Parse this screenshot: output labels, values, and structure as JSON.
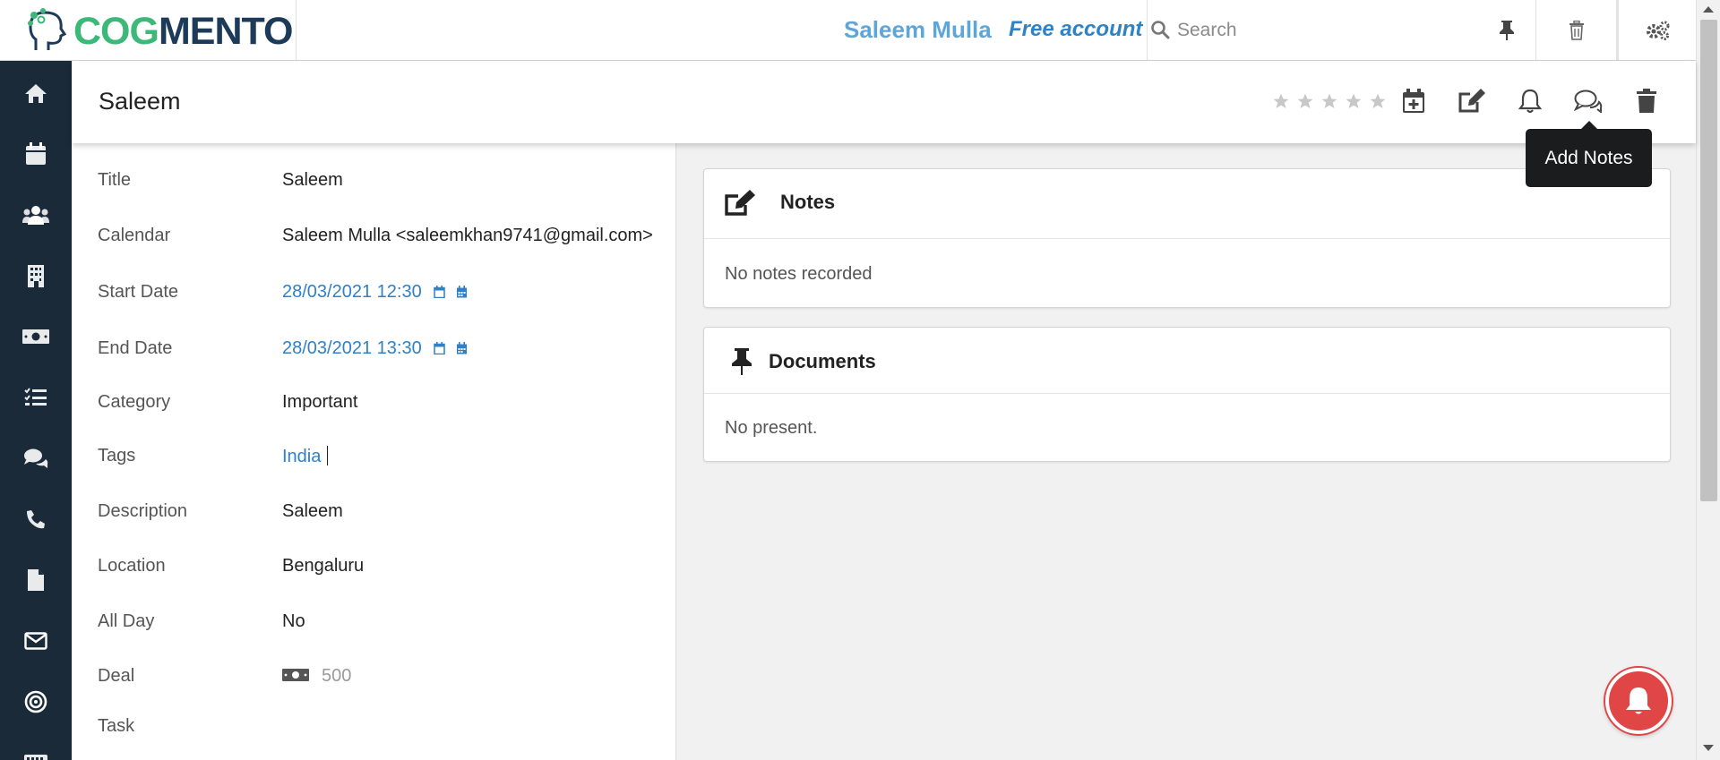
{
  "header": {
    "logo_prefix": "COG",
    "logo_suffix": "MENTO",
    "user_name": "Saleem Mulla",
    "account_type": "Free account",
    "search_placeholder": "Search",
    "icons": [
      "search-icon",
      "pin-icon",
      "trash-icon",
      "settings-icon"
    ]
  },
  "sidebar": {
    "items": [
      {
        "name": "home",
        "icon": "home-icon"
      },
      {
        "name": "calendar",
        "icon": "calendar-icon"
      },
      {
        "name": "contacts",
        "icon": "users-icon"
      },
      {
        "name": "companies",
        "icon": "building-icon"
      },
      {
        "name": "deals",
        "icon": "money-icon"
      },
      {
        "name": "tasks",
        "icon": "tasks-icon"
      },
      {
        "name": "cases",
        "icon": "comments-icon"
      },
      {
        "name": "calls",
        "icon": "phone-icon"
      },
      {
        "name": "documents",
        "icon": "file-icon"
      },
      {
        "name": "email",
        "icon": "mail-icon"
      },
      {
        "name": "campaigns",
        "icon": "target-icon"
      },
      {
        "name": "forms",
        "icon": "keyboard-icon"
      }
    ]
  },
  "record": {
    "title": "Saleem",
    "rating": 0,
    "rating_max": 5,
    "actions": [
      "add-to-calendar",
      "edit",
      "reminder",
      "add-notes",
      "delete"
    ],
    "tooltip": "Add Notes"
  },
  "details": {
    "fields": [
      {
        "label": "Title",
        "value": "Saleem"
      },
      {
        "label": "Calendar",
        "value": "Saleem Mulla <saleemkhan9741@gmail.com>"
      },
      {
        "label": "Start Date",
        "value": "28/03/2021 12:30"
      },
      {
        "label": "End Date",
        "value": "28/03/2021 13:30"
      },
      {
        "label": "Category",
        "value": "Important"
      },
      {
        "label": "Tags",
        "value": "India"
      },
      {
        "label": "Description",
        "value": "Saleem"
      },
      {
        "label": "Location",
        "value": "Bengaluru"
      },
      {
        "label": "All Day",
        "value": "No"
      },
      {
        "label": "Deal",
        "value": "500"
      },
      {
        "label": "Task",
        "value": ""
      }
    ]
  },
  "notes": {
    "title": "Notes",
    "empty_text": "No notes recorded"
  },
  "documents": {
    "title": "Documents",
    "empty_text": "No present."
  },
  "colors": {
    "sidebar": "#1b2a38",
    "link": "#2f80c6",
    "user_name": "#5ea6d8",
    "logo_green": "#3cb878",
    "logo_navy": "#1d3b58",
    "notification": "#e04646"
  }
}
